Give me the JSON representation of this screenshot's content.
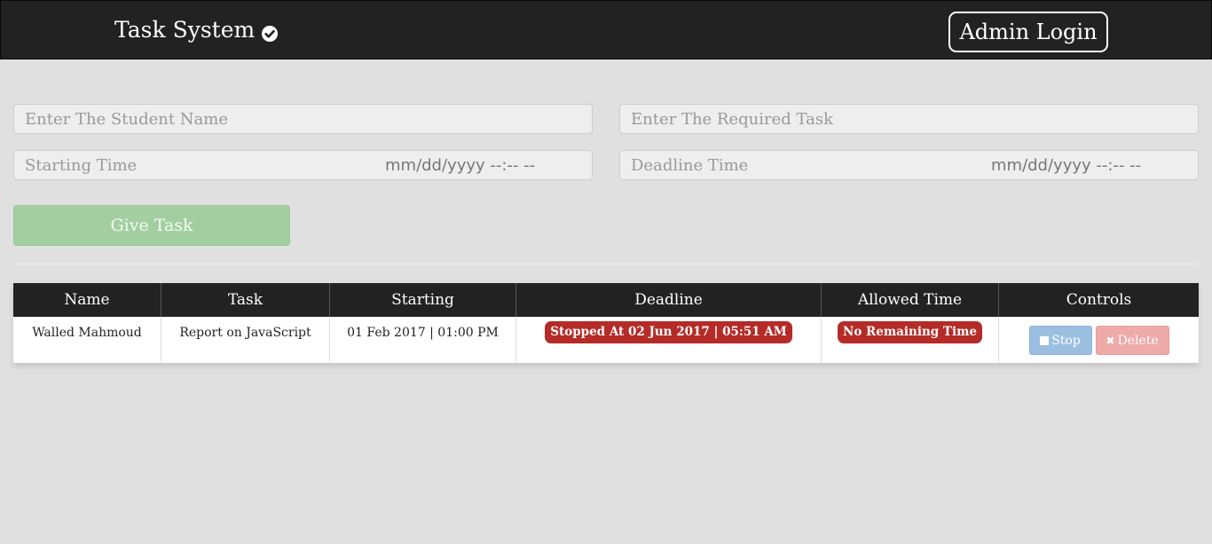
{
  "navbar": {
    "brand": "Task System",
    "brand_icon": "check-circle-icon",
    "admin_login": "Admin Login"
  },
  "form": {
    "student_name_placeholder": "Enter The Student Name",
    "task_placeholder": "Enter The Required Task",
    "starting_time_label": "Starting Time",
    "starting_time_mask": "mm/dd/yyyy --:-- --",
    "deadline_time_label": "Deadline Time",
    "deadline_time_mask": "mm/dd/yyyy --:-- --",
    "give_task": "Give Task"
  },
  "table": {
    "headers": [
      "Name",
      "Task",
      "Starting",
      "Deadline",
      "Allowed Time",
      "Controls"
    ],
    "rows": [
      {
        "name": "Walled Mahmoud",
        "task": "Report on JavaScript",
        "starting": "01 Feb 2017 | 01:00 PM",
        "deadline": "Stopped At 02 Jun 2017 | 05:51 AM",
        "allowed_time": "No Remaining Time",
        "stop_label": "Stop",
        "delete_label": "Delete"
      }
    ]
  },
  "colors": {
    "navbar": "#222222",
    "background": "#e0e0e0",
    "give_task_button": "#a3cfa0",
    "danger_badge": "#b52b27",
    "stop_button": "#9bbfe0",
    "delete_button": "#eeaaa9"
  }
}
